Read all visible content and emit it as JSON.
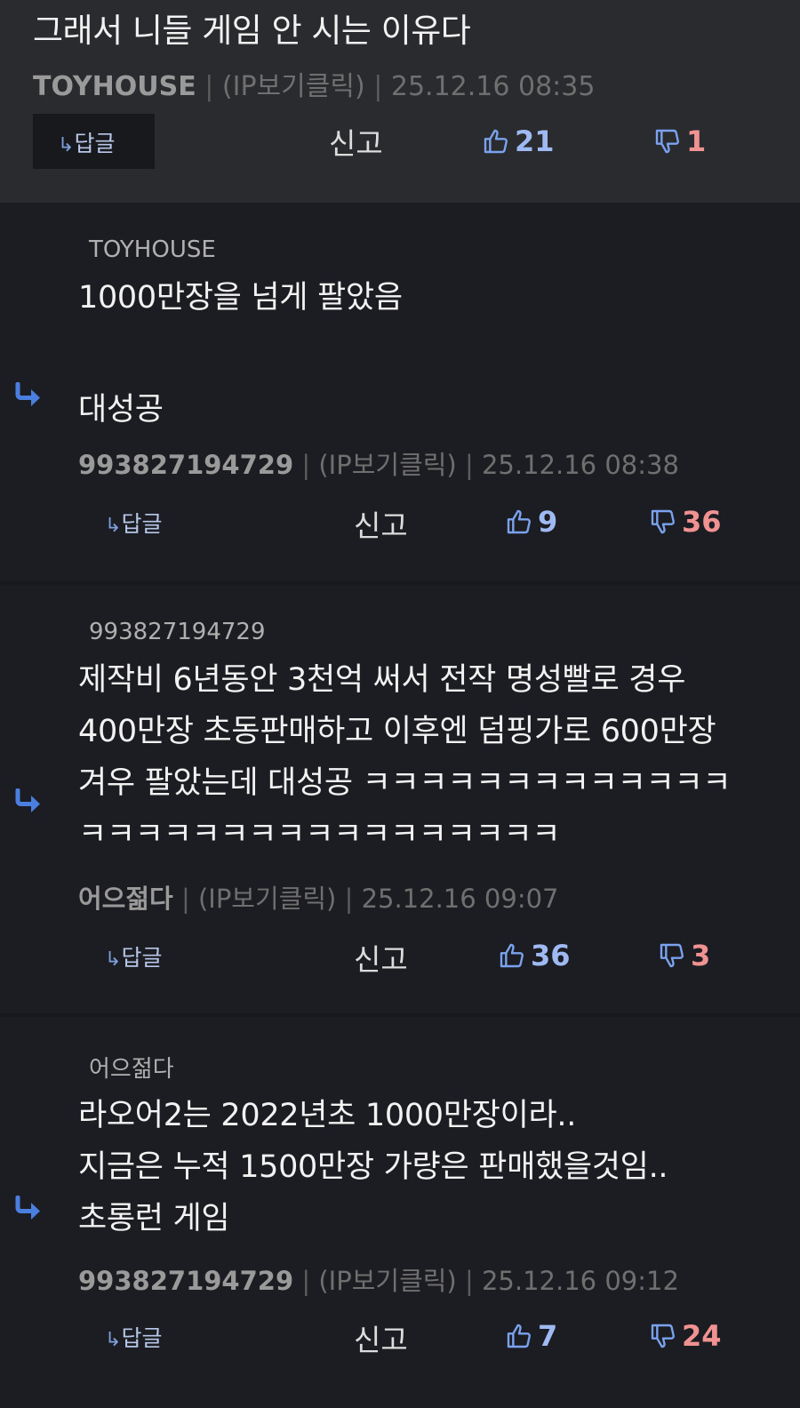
{
  "top": {
    "text": "그래서 니들 게임 안 시는 이유다",
    "author": "TOYHOUSE",
    "ip": "(IP보기클릭)",
    "time": "25.12.16 08:35",
    "reply_label": "답글",
    "report_label": "신고",
    "up": "21",
    "down": "1"
  },
  "comments": [
    {
      "reply_to": "TOYHOUSE",
      "lines": [
        "1000만장을 넘게 팔았음",
        "",
        "대성공"
      ],
      "author": "993827194729",
      "ip": "(IP보기클릭)",
      "time": "25.12.16 08:38",
      "reply_label": "답글",
      "report_label": "신고",
      "up": "9",
      "down": "36"
    },
    {
      "reply_to": "993827194729",
      "lines": [
        "제작비 6년동안 3천억 써서 전작 명성빨로 경우",
        "400만장 초동판매하고 이후엔 덤핑가로 600만장",
        "겨우 팔았는데 대성공 ㅋㅋㅋㅋㅋㅋㅋㅋㅋㅋㅋㅋㅋ",
        "ㅋㅋㅋㅋㅋㅋㅋㅋㅋㅋㅋㅋㅋㅋㅋㅋㅋ"
      ],
      "author": "어으젊다",
      "ip": "(IP보기클릭)",
      "time": "25.12.16 09:07",
      "reply_label": "답글",
      "report_label": "신고",
      "up": "36",
      "down": "3"
    },
    {
      "reply_to": "어으젊다",
      "lines": [
        "라오어2는 2022년초 1000만장이라..",
        "지금은 누적 1500만장 가량은 판매했을것임..",
        "초롱런 게임"
      ],
      "author": "993827194729",
      "ip": "(IP보기클릭)",
      "time": "25.12.16 09:12",
      "reply_label": "답글",
      "report_label": "신고",
      "up": "7",
      "down": "24"
    }
  ],
  "colors": {
    "accent_blue": "#4a7fe0",
    "up_color": "#9fb9f3",
    "down_color": "#f19292",
    "background": "#1c1d22",
    "top_background": "#2a2b2e"
  },
  "icons": [
    "reply-arrow-icon",
    "thumbs-up-icon",
    "thumbs-down-icon"
  ]
}
